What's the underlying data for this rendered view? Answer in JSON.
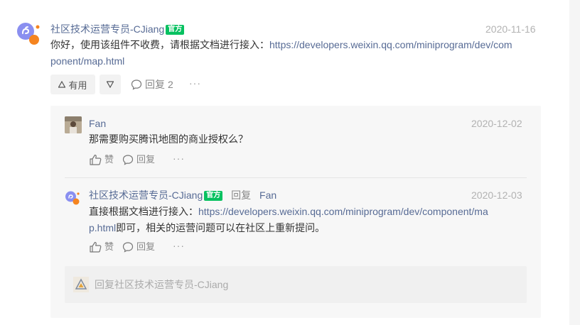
{
  "colors": {
    "link": "#576b95",
    "badge": "#07c160",
    "date": "#b2b2b2",
    "panel": "#f7f7f7"
  },
  "main_comment": {
    "author": "社区技术运营专员-CJiang",
    "badge": "官方",
    "date": "2020-11-16",
    "text_prefix": "你好，使用该组件不收费，请根据文档进行接入：",
    "link_line1": "https://developers.weixin.qq.com/miniprogram/dev/com",
    "link_line2": "ponent/map.html",
    "useful_label": "有用",
    "reply_label": "回复",
    "reply_count": "2",
    "more": "···"
  },
  "replies": [
    {
      "author": "Fan",
      "date": "2020-12-02",
      "text": "那需要购买腾讯地图的商业授权么？",
      "like_label": "赞",
      "reply_label": "回复",
      "more": "···"
    },
    {
      "author": "社区技术运营专员-CJiang",
      "badge": "官方",
      "reply_keyword": "回复",
      "reply_to": "Fan",
      "date": "2020-12-03",
      "text_prefix": "直接根据文档进行接入：",
      "link_line1": "https://developers.weixin.qq.com/miniprogram/dev/component/ma",
      "link_line2": "p.html",
      "text_suffix": "即可，相关的运营问题可以在社区上重新提问。",
      "like_label": "赞",
      "reply_label": "回复",
      "more": "···"
    }
  ],
  "reply_input": {
    "placeholder": "回复社区技术运营专员-CJiang"
  },
  "icons": [
    "miniprogram-logo-icon",
    "thumbs-up-icon",
    "comment-icon",
    "triangle-up-icon",
    "triangle-down-icon",
    "ellipsis-icon"
  ]
}
